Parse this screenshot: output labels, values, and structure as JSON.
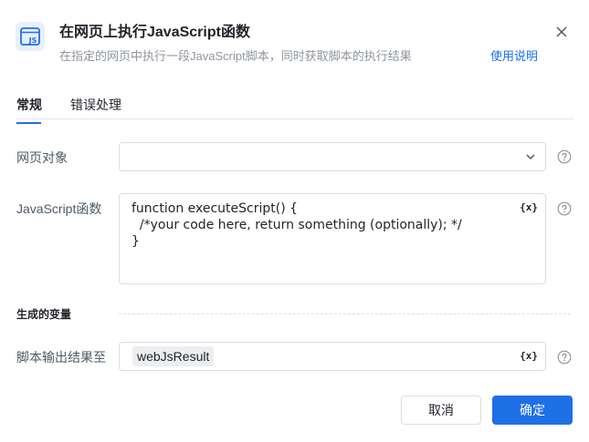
{
  "header": {
    "title": "在网页上执行JavaScript函数",
    "subtitle": "在指定的网页中执行一段JavaScript脚本，同时获取脚本的执行结果",
    "help_link": "使用说明",
    "icon_text": "JS"
  },
  "tabs": [
    {
      "label": "常规",
      "active": true
    },
    {
      "label": "错误处理",
      "active": false
    }
  ],
  "fields": {
    "page_object": {
      "label": "网页对象",
      "value": ""
    },
    "js_function": {
      "label": "JavaScript函数",
      "code": [
        "function executeScript() {",
        "  /*your code here, return something (optionally); */",
        "}"
      ],
      "var_icon": "{x}"
    }
  },
  "outputs": {
    "section_title": "生成的变量",
    "result": {
      "label": "脚本输出结果至",
      "value": "webJsResult",
      "var_icon": "{x}"
    }
  },
  "footer": {
    "cancel_label": "取消",
    "ok_label": "确定"
  },
  "colors": {
    "accent": "#1f6fe5",
    "label": "#4e5969",
    "subtle": "#8f959e"
  }
}
